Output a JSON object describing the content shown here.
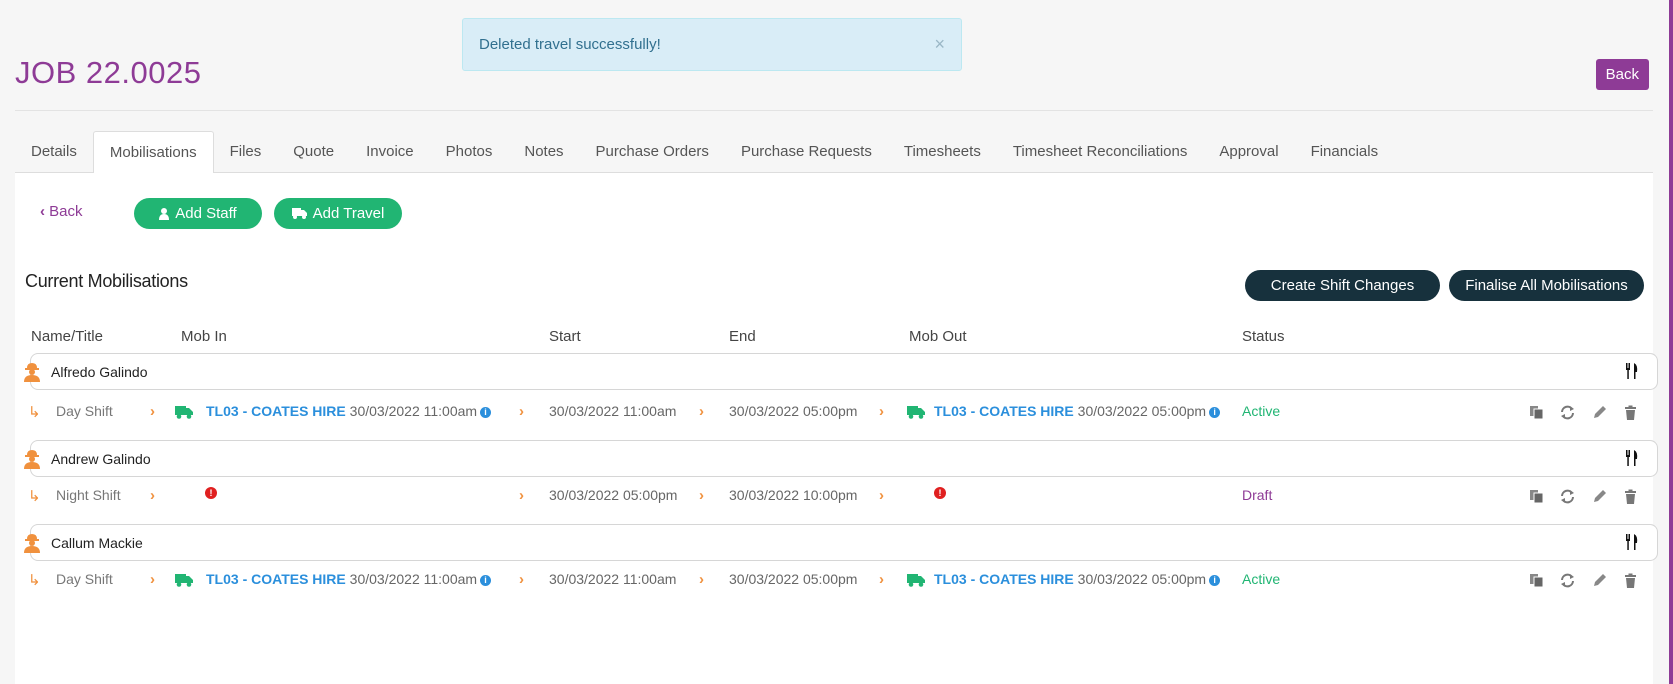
{
  "alert": {
    "message": "Deleted travel successfully!",
    "close": "×"
  },
  "job": {
    "title": "JOB 22.0025"
  },
  "top_back": "Back",
  "tabs": [
    "Details",
    "Mobilisations",
    "Files",
    "Quote",
    "Invoice",
    "Photos",
    "Notes",
    "Purchase Orders",
    "Purchase Requests",
    "Timesheets",
    "Timesheet Reconciliations",
    "Approval",
    "Financials"
  ],
  "active_tab": "Mobilisations",
  "toolbar": {
    "back": "Back",
    "add_staff": "Add Staff",
    "add_travel": "Add Travel"
  },
  "section": {
    "title": "Current Mobilisations",
    "create_shift_changes": "Create Shift Changes",
    "finalise_all": "Finalise All Mobilisations"
  },
  "columns": {
    "name": "Name/Title",
    "mob_in": "Mob In",
    "start": "Start",
    "end": "End",
    "mob_out": "Mob Out",
    "status": "Status"
  },
  "mobilisations": [
    {
      "name": "Alfredo Galindo",
      "shift": "Day Shift",
      "mob_in_link": "TL03 - COATES HIRE",
      "mob_in_time": "30/03/2022 11:00am",
      "start": "30/03/2022 11:00am",
      "end": "30/03/2022 05:00pm",
      "mob_out_link": "TL03 - COATES HIRE",
      "mob_out_time": "30/03/2022 05:00pm",
      "status": "Active"
    },
    {
      "name": "Andrew Galindo",
      "shift": "Night Shift",
      "start": "30/03/2022 05:00pm",
      "end": "30/03/2022 10:00pm",
      "status": "Draft"
    },
    {
      "name": "Callum Mackie",
      "shift": "Day Shift",
      "mob_in_link": "TL03 - COATES HIRE",
      "mob_in_time": "30/03/2022 11:00am",
      "start": "30/03/2022 11:00am",
      "end": "30/03/2022 05:00pm",
      "mob_out_link": "TL03 - COATES HIRE",
      "mob_out_time": "30/03/2022 05:00pm",
      "status": "Active"
    }
  ],
  "colors": {
    "brand": "#8e3b96",
    "green": "#21b573",
    "dark": "#17313d",
    "link": "#2b8fdc",
    "orange": "#f0913e",
    "alert_bg": "#d9edf7"
  }
}
